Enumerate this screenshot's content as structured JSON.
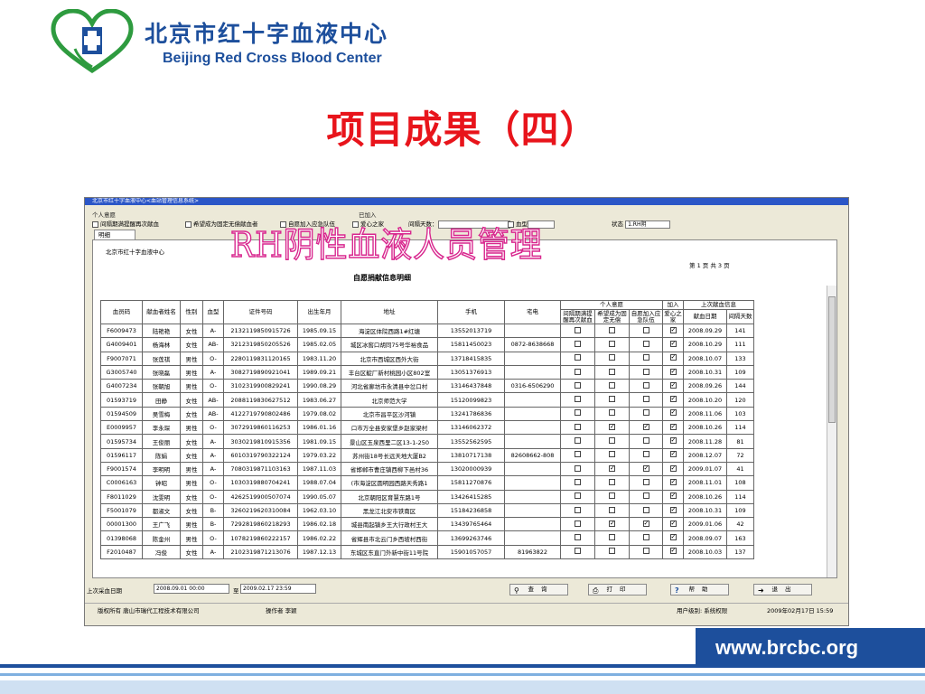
{
  "header": {
    "org_cn": "北京市红十字血液中心",
    "org_en": "Beijing Red Cross Blood Center",
    "slide_title": "项目成果（四）",
    "logo": "red-cross-heart-logo",
    "colors": {
      "brand": "#1d4f9c",
      "title": "#e8141b",
      "logo_green": "#2e9b3f",
      "overlay": "#d8278e"
    }
  },
  "app": {
    "window_title": "北京市红十字血液中心<血站管理信息系统>",
    "filter": {
      "group1_title": "个人意愿",
      "group2_title": "已加入",
      "opt_interval": "间隔期满提醒再次献血",
      "opt_fixed": "希望成为固定无偿献血者",
      "opt_emergency": "自愿加入应急队伍",
      "opt_home": "爱心之家",
      "interval_days_label": "间隔天数：",
      "blood_label": "血型",
      "status_label": "状态",
      "status_value": "1.RH阴"
    },
    "tab_label": "明细",
    "overlay_text": "RH阴性血液人员管理",
    "report": {
      "org": "北京市红十字血液中心",
      "page_info": "第 1 页  共 3 页",
      "title": "自愿捐献信息明细",
      "group_headers": {
        "personal": "个人意愿",
        "joined": "加入",
        "last": "上次献血信息"
      },
      "columns": [
        "血员码",
        "献血者姓名",
        "性别",
        "血型",
        "证件号码",
        "出生年月",
        "地址",
        "手机",
        "宅电",
        "间隔期满提醒再次献血",
        "希望成为固定无偿",
        "自愿加入应急队伍",
        "爱心之家",
        "献血日期",
        "间隔天数"
      ],
      "rows": [
        {
          "id": "F6009473",
          "name": "陆艳艳",
          "sex": "女性",
          "blood": "A-",
          "cert": "2132119850915726",
          "birth": "1985.09.15",
          "addr": "海淀区体院西路1#红塘",
          "mobile": "13552013719",
          "phone": "",
          "c1": false,
          "c2": false,
          "c3": false,
          "c4": true,
          "date": "2008.09.29",
          "days": "141"
        },
        {
          "id": "G4009401",
          "name": "杨海林",
          "sex": "女性",
          "blood": "AB-",
          "cert": "3212319850205526",
          "birth": "1985.02.05",
          "addr": "城区冰窖口胡同75号华裕食品",
          "mobile": "15811450023",
          "phone": "0872-8638668",
          "c1": false,
          "c2": false,
          "c3": false,
          "c4": true,
          "date": "2008.10.29",
          "days": "111"
        },
        {
          "id": "F9007071",
          "name": "张莲祺",
          "sex": "男性",
          "blood": "O-",
          "cert": "2280119831120165",
          "birth": "1983.11.20",
          "addr": "北京市西城区西外大街",
          "mobile": "13718415835",
          "phone": "",
          "c1": false,
          "c2": false,
          "c3": false,
          "c4": true,
          "date": "2008.10.07",
          "days": "133"
        },
        {
          "id": "G3005740",
          "name": "张晓磊",
          "sex": "男性",
          "blood": "A-",
          "cert": "3082719890921041",
          "birth": "1989.09.21",
          "addr": "丰台区靛厂新村桃园小区802室",
          "mobile": "13051376913",
          "phone": "",
          "c1": false,
          "c2": false,
          "c3": false,
          "c4": true,
          "date": "2008.10.31",
          "days": "109"
        },
        {
          "id": "G4007234",
          "name": "张朝旭",
          "sex": "男性",
          "blood": "O-",
          "cert": "3102319900829241",
          "birth": "1990.08.29",
          "addr": "河北省廊坊市永清县中岔口村",
          "mobile": "13146437848",
          "phone": "0316-6506290",
          "c1": false,
          "c2": false,
          "c3": false,
          "c4": true,
          "date": "2008.09.26",
          "days": "144"
        },
        {
          "id": "01593719",
          "name": "田静",
          "sex": "女性",
          "blood": "AB-",
          "cert": "2088119830627512",
          "birth": "1983.06.27",
          "addr": "北京师范大学",
          "mobile": "15120099823",
          "phone": "",
          "c1": false,
          "c2": false,
          "c3": false,
          "c4": true,
          "date": "2008.10.20",
          "days": "120"
        },
        {
          "id": "01594509",
          "name": "吴雪梅",
          "sex": "女性",
          "blood": "AB-",
          "cert": "4122719790802486",
          "birth": "1979.08.02",
          "addr": "北京市昌平区沙河镇",
          "mobile": "13241786836",
          "phone": "",
          "c1": false,
          "c2": false,
          "c3": false,
          "c4": true,
          "date": "2008.11.06",
          "days": "103"
        },
        {
          "id": "E0009957",
          "name": "李永琛",
          "sex": "男性",
          "blood": "O-",
          "cert": "3072919860116253",
          "birth": "1986.01.16",
          "addr": "口市万全县安家堡乡赵家梁村",
          "mobile": "13146062372",
          "phone": "",
          "c1": false,
          "c2": true,
          "c3": true,
          "c4": true,
          "date": "2008.10.26",
          "days": "114"
        },
        {
          "id": "01595734",
          "name": "王俊丽",
          "sex": "女性",
          "blood": "A-",
          "cert": "3030219810915356",
          "birth": "1981.09.15",
          "addr": "景山区玉泉西里二区13-1-250",
          "mobile": "13552562595",
          "phone": "",
          "c1": false,
          "c2": false,
          "c3": false,
          "c4": true,
          "date": "2008.11.28",
          "days": "81"
        },
        {
          "id": "01596117",
          "name": "陈娟",
          "sex": "女性",
          "blood": "A-",
          "cert": "6010319790322124",
          "birth": "1979.03.22",
          "addr": "苏州街18号长远天地大厦B2",
          "mobile": "13810717138",
          "phone": "82608662-808",
          "c1": false,
          "c2": false,
          "c3": false,
          "c4": true,
          "date": "2008.12.07",
          "days": "72"
        },
        {
          "id": "F9001574",
          "name": "李明明",
          "sex": "男性",
          "blood": "A-",
          "cert": "7080319871103163",
          "birth": "1987.11.03",
          "addr": "省邯郸市曹庄镇西柳下邑村36",
          "mobile": "13020000939",
          "phone": "",
          "c1": false,
          "c2": true,
          "c3": true,
          "c4": true,
          "date": "2009.01.07",
          "days": "41"
        },
        {
          "id": "C0006163",
          "name": "钟昭",
          "sex": "男性",
          "blood": "O-",
          "cert": "1030319880704241",
          "birth": "1988.07.04",
          "addr": "(市海淀区圆明园西路天秀路1",
          "mobile": "15811270876",
          "phone": "",
          "c1": false,
          "c2": false,
          "c3": false,
          "c4": true,
          "date": "2008.11.01",
          "days": "108"
        },
        {
          "id": "F8011029",
          "name": "沈雯明",
          "sex": "女性",
          "blood": "O-",
          "cert": "4262519900507074",
          "birth": "1990.05.07",
          "addr": "北京朝阳区育慧东路1号",
          "mobile": "13426415285",
          "phone": "",
          "c1": false,
          "c2": false,
          "c3": false,
          "c4": true,
          "date": "2008.10.26",
          "days": "114"
        },
        {
          "id": "F5001079",
          "name": "都淑文",
          "sex": "女性",
          "blood": "B-",
          "cert": "3260219620310084",
          "birth": "1962.03.10",
          "addr": "黑龙江北安市铁南区",
          "mobile": "15184236858",
          "phone": "",
          "c1": false,
          "c2": false,
          "c3": false,
          "c4": true,
          "date": "2008.10.31",
          "days": "109"
        },
        {
          "id": "00001300",
          "name": "王广飞",
          "sex": "男性",
          "blood": "B-",
          "cert": "7292819860218293",
          "birth": "1986.02.18",
          "addr": "城县南起镇乡王大行政村王大",
          "mobile": "13439765464",
          "phone": "",
          "c1": false,
          "c2": true,
          "c3": true,
          "c4": true,
          "date": "2009.01.06",
          "days": "42"
        },
        {
          "id": "01398068",
          "name": "陈金州",
          "sex": "男性",
          "blood": "O-",
          "cert": "1078219860222157",
          "birth": "1986.02.22",
          "addr": "省辉县市北云门乡西坡村西街",
          "mobile": "13699263746",
          "phone": "",
          "c1": false,
          "c2": false,
          "c3": false,
          "c4": true,
          "date": "2008.09.07",
          "days": "163"
        },
        {
          "id": "F2010487",
          "name": "冯俊",
          "sex": "女性",
          "blood": "A-",
          "cert": "2102319871213076",
          "birth": "1987.12.13",
          "addr": "东城区东直门外新中街11号院",
          "mobile": "15901057057",
          "phone": "81963822",
          "c1": false,
          "c2": false,
          "c3": false,
          "c4": true,
          "date": "2008.10.03",
          "days": "137"
        }
      ]
    },
    "bottom": {
      "last_date_label": "上次采血日期",
      "from": "2008.09.01 00:00",
      "to_label": "至",
      "to": "2009.02.17 23:59",
      "query": "查 询",
      "print": "打 印",
      "help": "帮 助",
      "exit": "退 出"
    },
    "status": {
      "copyright": "版权所有  唐山市瑞代工程技术有限公司",
      "operator": "操作者  李颖",
      "level": "用户级别: 系统权限",
      "datetime": "2009年02月17日  15:59"
    }
  },
  "footer": {
    "url": "www.brcbc.org"
  }
}
